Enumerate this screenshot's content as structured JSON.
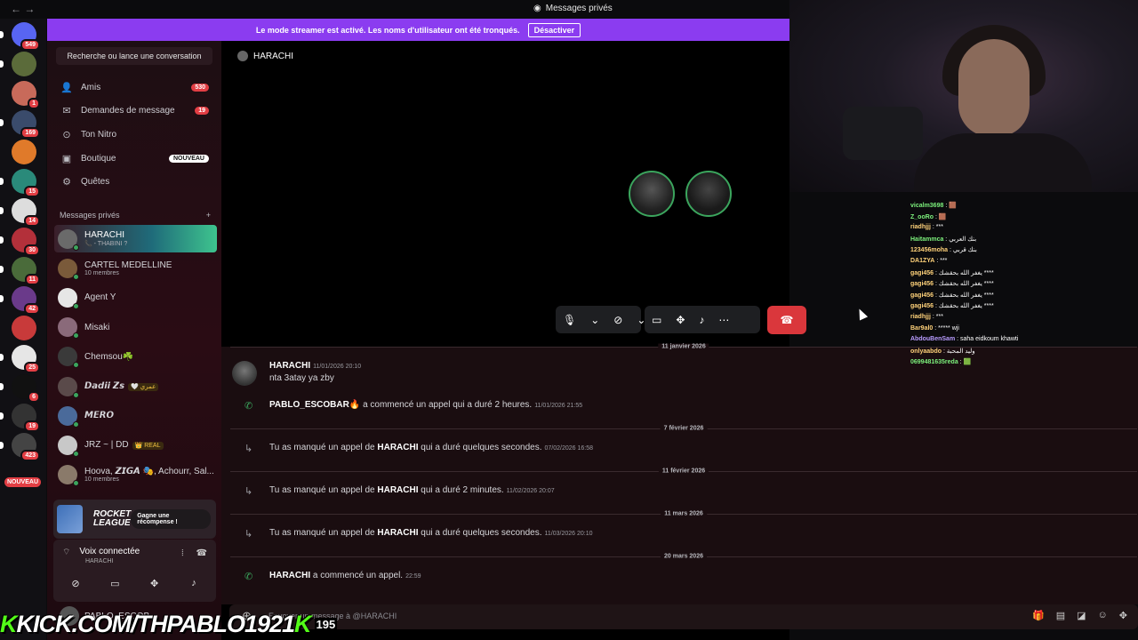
{
  "titlebar": {
    "nav": "← →",
    "title": "Messages privés"
  },
  "banner": {
    "text": "Le mode streamer est activé. Les noms d'utilisateur ont été tronqués.",
    "button": "Désactiver"
  },
  "guilds": [
    {
      "badge": "549",
      "color": "#5865f2",
      "pip": true
    },
    {
      "badge": "",
      "color": "#5b6b3a",
      "pip": true
    },
    {
      "badge": "1",
      "color": "#c86a5a",
      "pip": false
    },
    {
      "badge": "169",
      "color": "#3a4b6b",
      "pip": true
    },
    {
      "badge": "",
      "color": "#e07a2a",
      "pip": false
    },
    {
      "badge": "15",
      "color": "#2a8a7a",
      "pip": true
    },
    {
      "badge": "14",
      "color": "#ddd",
      "pip": true
    },
    {
      "badge": "30",
      "color": "#b3303a",
      "pip": true
    },
    {
      "badge": "11",
      "color": "#4a6b3a",
      "pip": true
    },
    {
      "badge": "42",
      "color": "#6a3a8a",
      "pip": true
    },
    {
      "badge": "",
      "color": "#c83a3a",
      "pip": false
    },
    {
      "badge": "25",
      "color": "#e6e6e6",
      "pip": true
    },
    {
      "badge": "6",
      "color": "#111",
      "pip": true
    },
    {
      "badge": "19",
      "color": "#333",
      "pip": true
    },
    {
      "badge": "423",
      "color": "#444",
      "pip": true
    }
  ],
  "guild_new": "NOUVEAU",
  "sidebar": {
    "search": "Recherche ou lance une conversation",
    "nav": [
      {
        "icon": "👤",
        "label": "Amis",
        "count": "530"
      },
      {
        "icon": "✉",
        "label": "Demandes de message",
        "count": "19"
      },
      {
        "icon": "⊙",
        "label": "Ton Nitro",
        "count": ""
      },
      {
        "icon": "▣",
        "label": "Boutique",
        "count": "",
        "new": "NOUVEAU"
      },
      {
        "icon": "⚙",
        "label": "Quêtes",
        "count": ""
      }
    ],
    "mp_header": "Messages privés",
    "mp_add": "+",
    "dms": [
      {
        "name": "HARACHI",
        "sub": "📞 - THABINI ?",
        "active": true,
        "color": "#6a6a6a"
      },
      {
        "name": "CARTEL MEDELLINE",
        "sub": "10 membres",
        "color": "#7a5a3a"
      },
      {
        "name": "Agent Y",
        "sub": "",
        "color": "#e6e6e6"
      },
      {
        "name": "Misaki",
        "sub": "",
        "color": "#8a6a7a"
      },
      {
        "name": "Chemsou☘️",
        "sub": "",
        "color": "#3a3a3a"
      },
      {
        "name": "𝘿𝙖𝙙𝙞𝙞 𝙕𝙨",
        "sub": "",
        "tag": "🤍 عمري",
        "color": "#5a4a4a"
      },
      {
        "name": "𝙈𝙀𝙍𝙊",
        "sub": "",
        "color": "#4a6a9a"
      },
      {
        "name": "JRZ ~ | DD",
        "sub": "",
        "tag": "👑 REAL",
        "color": "#c8c8c8"
      },
      {
        "name": "Hoova, 𝙕𝙄𝙂𝘼 🎭, Achourr, Sal...",
        "sub": "10 membres",
        "color": "#8a7a6a"
      }
    ],
    "promo": {
      "logo_line1": "ROCKET",
      "logo_line2": "LEAGUE",
      "button": "Gagne une récompense !"
    },
    "voice": {
      "status": "Voix connectée",
      "channel": "HARACHI"
    },
    "user": {
      "name": "PABLO_ESCOB..."
    }
  },
  "call": {
    "name": "HARACHI"
  },
  "chat": {
    "dividers": [
      "11 janvier 2026",
      "7 février 2026",
      "11 février 2026",
      "11 mars 2026",
      "20 mars 2026"
    ],
    "msg1": {
      "author": "HARACHI",
      "time": "11/01/2026 20:10",
      "text": "nta 3atay ya zby"
    },
    "call1": {
      "author": "PABLO_ESCOBAR🔥",
      "text": "a commencé un appel qui a duré 2 heures.",
      "time": "11/01/2026 21:55"
    },
    "missed1": {
      "pre": "Tu as manqué un appel de",
      "author": "HARACHI",
      "post": "qui a duré quelques secondes.",
      "time": "07/02/2026 16:58"
    },
    "missed2": {
      "pre": "Tu as manqué un appel de",
      "author": "HARACHI",
      "post": "qui a duré 2 minutes.",
      "time": "11/02/2026 20:07"
    },
    "missed3": {
      "pre": "Tu as manqué un appel de",
      "author": "HARACHI",
      "post": "qui a duré quelques secondes.",
      "time": "11/03/2026 20:10"
    },
    "call2": {
      "author": "HARACHI",
      "text": "a commencé un appel.",
      "time": "22:59"
    },
    "composer_placeholder": "Envoyer un message à @HARACHI"
  },
  "stream": {
    "kick_prefix": "K",
    "kick_text": "KICK.COM/THPABLO1921",
    "kick_suffix": "K",
    "viewers": "195",
    "chat": [
      {
        "user": "vicalm3698",
        "msg": "🟫",
        "color": "#7cf07c"
      },
      {
        "user": "Z_ooRo",
        "msg": "🟫",
        "color": "#7cf07c"
      },
      {
        "user": "riadhjjj",
        "msg": "***",
        "color": "#ffd27a"
      },
      {
        "user": "Haitammca",
        "msg": "بنك العربي",
        "color": "#7cf07c"
      },
      {
        "user": "123456moha",
        "msg": "بنك قربي",
        "color": "#ffd27a"
      },
      {
        "user": "DA1ZYA",
        "msg": "***",
        "color": "#ffd27a"
      },
      {
        "user": "gagi456",
        "msg": "يغفر الله بحقشك ****",
        "color": "#ffd27a"
      },
      {
        "user": "gagi456",
        "msg": "يغفر الله بحقشك ****",
        "color": "#ffd27a"
      },
      {
        "user": "gagi456",
        "msg": "يغفر الله بحقشك ****",
        "color": "#ffd27a"
      },
      {
        "user": "gagi456",
        "msg": "يغفر الله بحقشك ****",
        "color": "#ffd27a"
      },
      {
        "user": "riadhjjj",
        "msg": "***",
        "color": "#ffd27a"
      },
      {
        "user": "Bar9al0",
        "msg": "***** wji",
        "color": "#ffd27a"
      },
      {
        "user": "AbdouBenSam",
        "msg": "saha eidkoum khawti",
        "color": "#b89cff"
      },
      {
        "user": "onlyaabdo",
        "msg": "وليد المحبة",
        "color": "#ffd27a"
      },
      {
        "user": "0699481635reda",
        "msg": "🟩",
        "color": "#7cf07c"
      }
    ]
  }
}
